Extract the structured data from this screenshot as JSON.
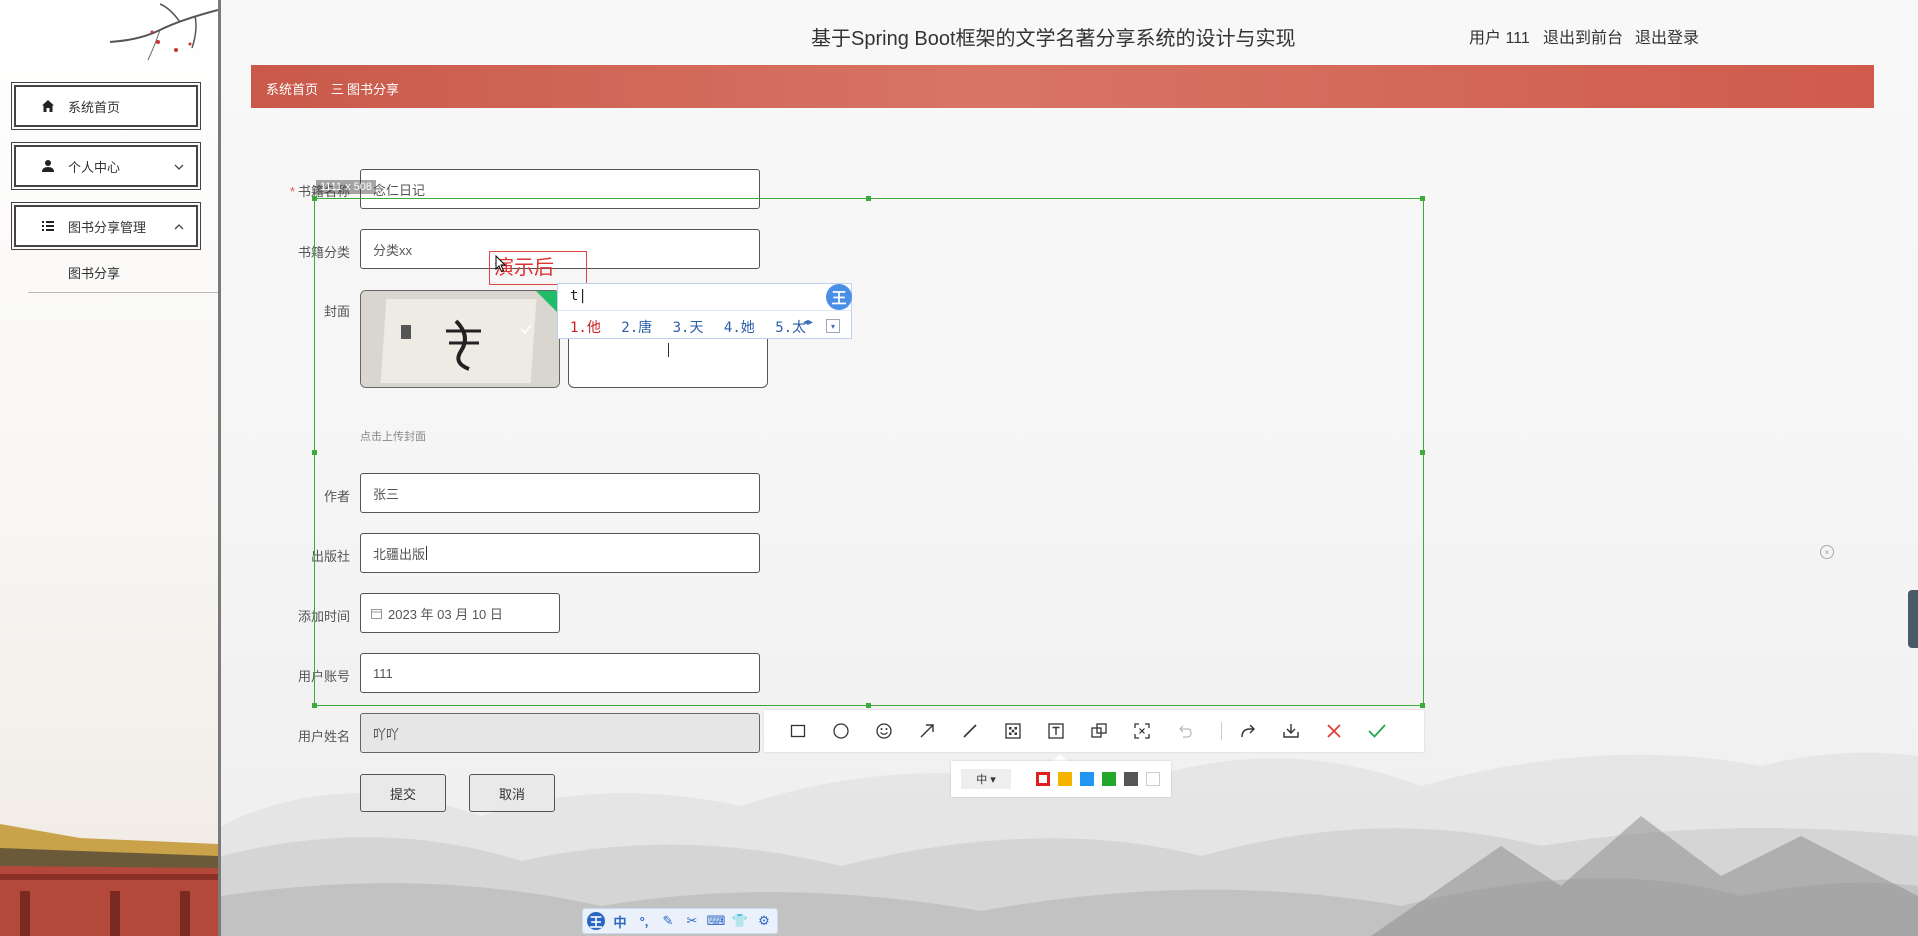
{
  "app": {
    "title": "基于Spring Boot框架的文学名著分享系统的设计与实现",
    "user_label": "用户 111",
    "to_front_label": "退出到前台",
    "logout_label": "退出登录"
  },
  "sidebar": {
    "items": [
      {
        "label": "系统首页",
        "icon": "home-icon"
      },
      {
        "label": "个人中心",
        "icon": "user-icon"
      },
      {
        "label": "图书分享管理",
        "icon": "list-icon"
      }
    ],
    "sub_items": [
      {
        "label": "图书分享"
      }
    ]
  },
  "breadcrumb": {
    "home": "系统首页",
    "separator": "三",
    "current": "图书分享"
  },
  "form": {
    "book_name": {
      "label": "书籍名称",
      "value": "念仁日记"
    },
    "category": {
      "label": "书籍分类",
      "value": "分类xx"
    },
    "cover": {
      "label": "封面",
      "hint": "点击上传封面"
    },
    "author": {
      "label": "作者",
      "value": "张三"
    },
    "publisher": {
      "label": "出版社",
      "value": "北疆出版"
    },
    "added_time": {
      "label": "添加时间",
      "value": "2023 年 03 月 10 日"
    },
    "account": {
      "label": "用户账号",
      "value": "111"
    },
    "username": {
      "label": "用户姓名",
      "value": "吖吖"
    },
    "submit_label": "提交",
    "cancel_label": "取消"
  },
  "screenshot_tool": {
    "size_readout": "1111 x 508",
    "text_annotation": "演示后",
    "tools": [
      "rectangle-tool",
      "ellipse-tool",
      "emoji-tool",
      "arrow-tool",
      "line-tool",
      "mosaic-tool",
      "text-tool",
      "pin-tool",
      "ocr-tool",
      "undo-tool",
      "share-tool",
      "download-tool",
      "cancel-tool",
      "confirm-tool"
    ],
    "font_size": "中",
    "colors": [
      "#e02020",
      "#f5b400",
      "#2196f3",
      "#22a82a",
      "#555555",
      "#ffffff"
    ],
    "selected_color": "#e02020"
  },
  "ime": {
    "input": "t|",
    "candidates": [
      "1.他",
      "2.唐",
      "3.天",
      "4.她",
      "5.太"
    ],
    "logo": "王",
    "toolbar": [
      "王",
      "中",
      "°,",
      "✎",
      "✂",
      "⌨",
      "👕",
      "⚙"
    ]
  }
}
